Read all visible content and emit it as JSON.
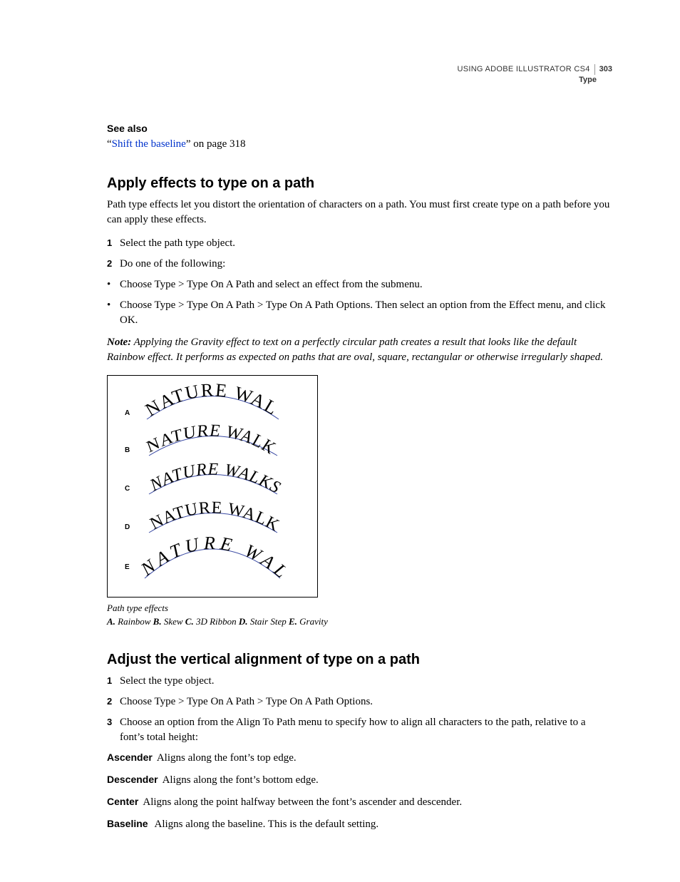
{
  "header": {
    "title": "USING ADOBE ILLUSTRATOR CS4",
    "page_number": "303",
    "section": "Type"
  },
  "see_also": {
    "heading": "See also",
    "link_text": "Shift the baseline",
    "quote_open": "“",
    "quote_close": "” on page 318"
  },
  "section1": {
    "heading": "Apply effects to type on a path",
    "intro": "Path type effects let you distort the orientation of characters on a path. You must first create type on a path before you can apply these effects.",
    "steps": [
      {
        "n": "1",
        "t": "Select the path type object."
      },
      {
        "n": "2",
        "t": "Do one of the following:"
      }
    ],
    "bullets": [
      "Choose Type > Type On A Path and select an effect from the submenu.",
      "Choose Type > Type On A Path > Type On A Path Options. Then select an option from the Effect menu, and click OK."
    ],
    "note_label": "Note:",
    "note_text": " Applying the Gravity effect to text on a perfectly circular path creates a result that looks like the default Rainbow effect. It performs as expected on paths that are oval, square, rectangular or otherwise irregularly shaped."
  },
  "figure": {
    "labels": [
      "A",
      "B",
      "C",
      "D",
      "E"
    ],
    "sample_text": "NATURE WALKS",
    "caption_title": "Path type effects",
    "caption_key_parts": [
      {
        "k": "A.",
        "v": " Rainbow  "
      },
      {
        "k": "B.",
        "v": " Skew  "
      },
      {
        "k": "C.",
        "v": " 3D Ribbon  "
      },
      {
        "k": "D.",
        "v": " Stair Step  "
      },
      {
        "k": "E.",
        "v": " Gravity"
      }
    ]
  },
  "section2": {
    "heading": "Adjust the vertical alignment of type on a path",
    "steps": [
      {
        "n": "1",
        "t": "Select the type object."
      },
      {
        "n": "2",
        "t": "Choose Type > Type On A Path > Type On A Path Options."
      },
      {
        "n": "3",
        "t": "Choose an option from the Align To Path menu to specify how to align all characters to the path, relative to a font’s total height:"
      }
    ],
    "defs": [
      {
        "term": "Ascender",
        "desc": "Aligns along the font’s top edge."
      },
      {
        "term": "Descender",
        "desc": "Aligns along the font’s bottom edge."
      },
      {
        "term": "Center",
        "desc": "Aligns along the point halfway between the font’s ascender and descender."
      },
      {
        "term": "Baseline",
        "desc": " Aligns along the baseline. This is the default setting."
      }
    ]
  }
}
